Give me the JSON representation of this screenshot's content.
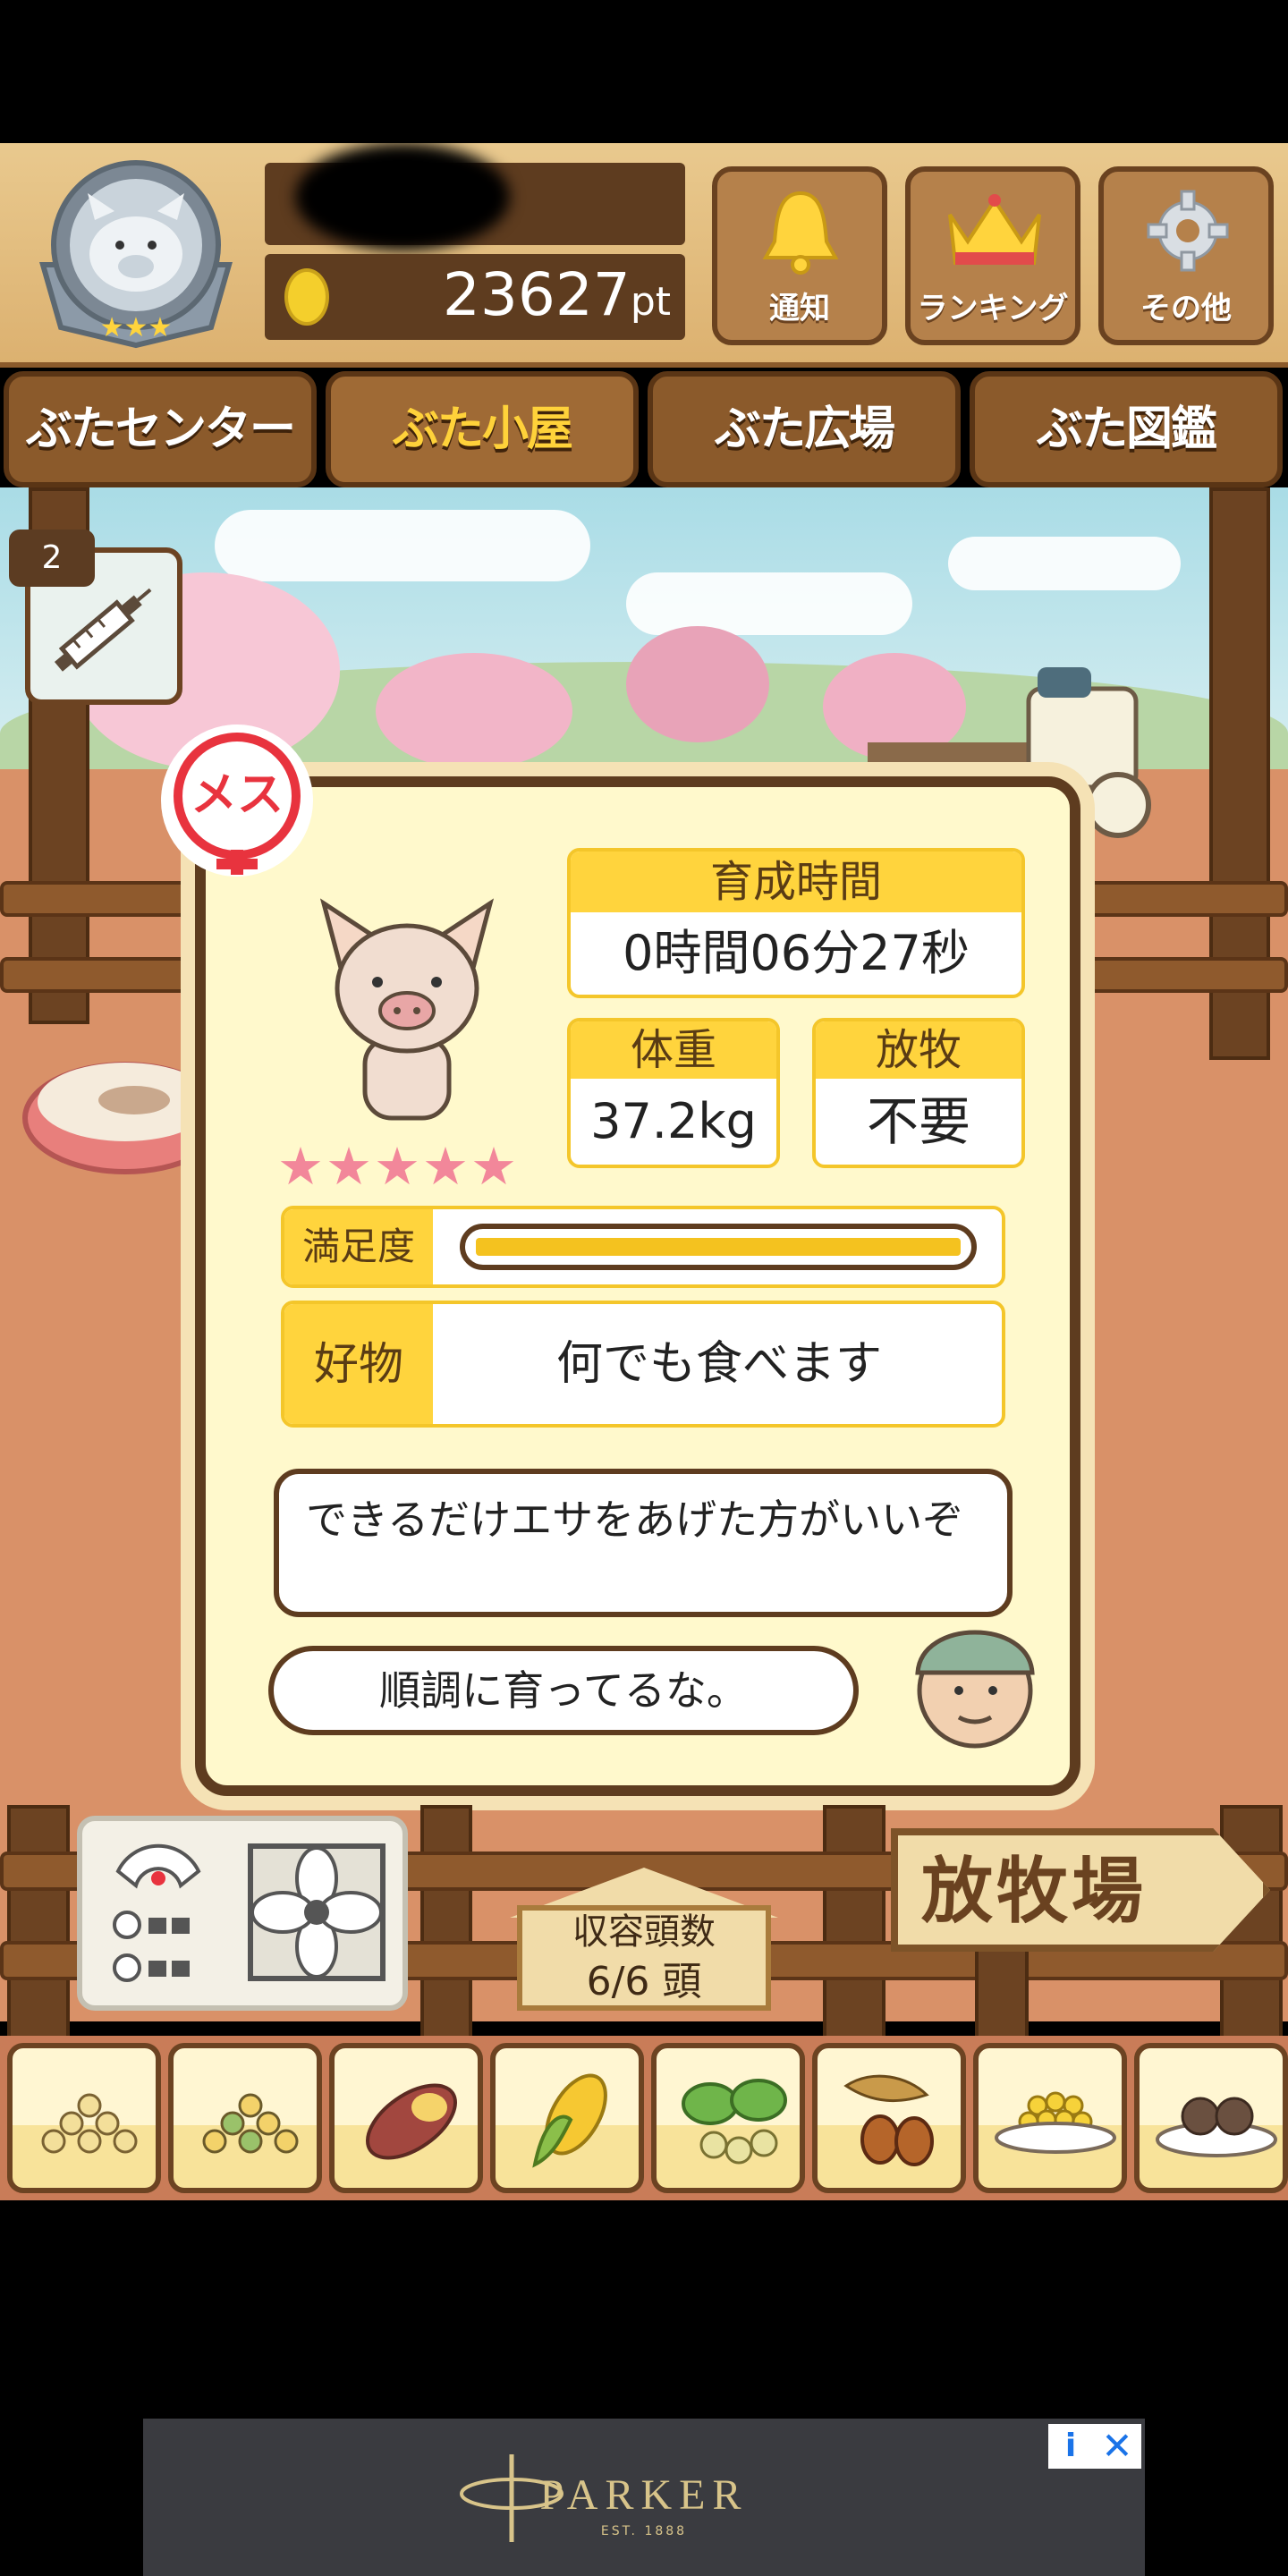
{
  "header": {
    "points_value": "23627",
    "points_unit": "pt",
    "buttons": [
      {
        "label": "通知",
        "icon": "bell-icon"
      },
      {
        "label": "ランキング",
        "icon": "crown-icon"
      },
      {
        "label": "その他",
        "icon": "gear-icon"
      }
    ]
  },
  "tabs": [
    {
      "label": "ぶたセンター",
      "active": false
    },
    {
      "label": "ぶた小屋",
      "active": true
    },
    {
      "label": "ぶた広場",
      "active": false
    },
    {
      "label": "ぶた図鑑",
      "active": false
    }
  ],
  "item": {
    "count": "2",
    "icon": "syringe-icon"
  },
  "pig_card": {
    "gender": "メス",
    "stars": "★★★★★",
    "growth_time_label": "育成時間",
    "growth_time_value": "0時間06分27秒",
    "weight_label": "体重",
    "weight_value": "37.2kg",
    "grazing_label": "放牧",
    "grazing_value": "不要",
    "satisfaction_label": "満足度",
    "satisfaction_level": 1.0,
    "favorite_label": "好物",
    "favorite_value": "何でも食べます",
    "advice_text": "できるだけエサをあげた方がいいぞ",
    "status_text": "順調に育ってるな。"
  },
  "capacity": {
    "label": "収容頭数",
    "value": "6/6 頭"
  },
  "range_sign": "放牧場",
  "feeds": [
    {
      "icon": "soybean-icon"
    },
    {
      "icon": "mixed-beans-icon"
    },
    {
      "icon": "sweet-potato-icon"
    },
    {
      "icon": "corn-icon"
    },
    {
      "icon": "greens-icon"
    },
    {
      "icon": "acorn-icon"
    },
    {
      "icon": "grain-bowl-icon"
    },
    {
      "icon": "chestnut-plate-icon"
    }
  ],
  "ad": {
    "brand": "PARKER",
    "sub": "EST. 1888",
    "info_glyph": "i",
    "close_glyph": "✕"
  },
  "colors": {
    "accent_yellow": "#ffd43d",
    "wood_brown": "#8b5a2b",
    "star_pink": "#f2879a",
    "gender_red": "#e8333e"
  }
}
